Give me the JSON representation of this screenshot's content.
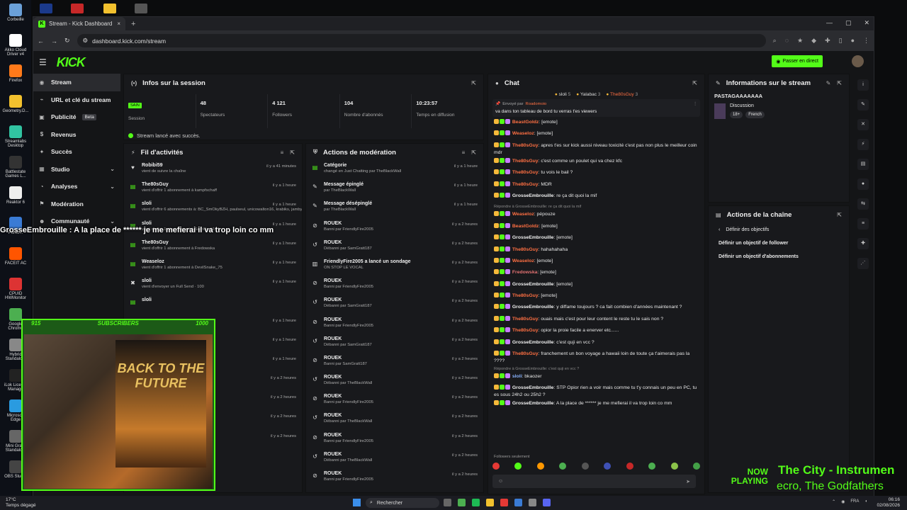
{
  "desktop": {
    "icons": [
      {
        "label": "Corbeille",
        "color": "#6aa0d8"
      },
      {
        "label": "Akko Cloud Driver v4",
        "color": "#ffffff"
      },
      {
        "label": "Firefox",
        "color": "#ff7a1a"
      },
      {
        "label": "Geometry.D...",
        "color": "#f2c12e"
      },
      {
        "label": "Streamlabs Desktop",
        "color": "#31c3a2"
      },
      {
        "label": "Battlestate Games L...",
        "color": "#333333"
      },
      {
        "label": "Reaktor 6",
        "color": "#eeeeee"
      },
      {
        "label": "Punto...",
        "color": "#3a7bd5"
      },
      {
        "label": "FACEIT AC",
        "color": "#ff5500"
      },
      {
        "label": "CPUID HWMonitor",
        "color": "#d33"
      },
      {
        "label": "Google Chrome",
        "color": "#4caf50"
      },
      {
        "label": "Hybrid Standalo...",
        "color": "#888"
      },
      {
        "label": "iLok Licen... Manage",
        "color": "#222"
      },
      {
        "label": "Microsoft Edge",
        "color": "#2a9be0"
      },
      {
        "label": "Mini Gra... Standalo...",
        "color": "#666"
      },
      {
        "label": "OBS Stud...",
        "color": "#444"
      }
    ]
  },
  "browser": {
    "tab_title": "Stream - Kick Dashboard",
    "tab_close": "×",
    "new_tab": "+",
    "window_controls": [
      "—",
      "▢",
      "✕"
    ],
    "url": "dashboard.kick.com/stream"
  },
  "header": {
    "logo": "KICK",
    "go_live_label": "Passer en direct"
  },
  "sidebar": {
    "items": [
      {
        "icon": "◉",
        "label": "Stream",
        "active": true
      },
      {
        "icon": "⌁",
        "label": "URL et clé du stream"
      },
      {
        "icon": "▣",
        "label": "Publicité",
        "badge": "Beta"
      },
      {
        "icon": "$",
        "label": "Revenus"
      },
      {
        "icon": "✦",
        "label": "Succès"
      },
      {
        "icon": "▦",
        "label": "Studio",
        "chevron": "⌄"
      },
      {
        "icon": "◔",
        "label": "Analyses",
        "chevron": "⌄"
      },
      {
        "icon": "⚑",
        "label": "Modération"
      },
      {
        "icon": "☻",
        "label": "Communauté",
        "chevron": "⌄"
      }
    ]
  },
  "session": {
    "title": "Infos sur la session",
    "stats": [
      {
        "value": "SAIN",
        "label": "Session"
      },
      {
        "value": "48",
        "label": "Spectateurs"
      },
      {
        "value": "4 121",
        "label": "Followers"
      },
      {
        "value": "104",
        "label": "Nombre d'abonnés"
      },
      {
        "value": "10:23:57",
        "label": "Temps en diffusion"
      }
    ],
    "success_message": "Stream lancé avec succès."
  },
  "activity": {
    "title": "Fil d'activités",
    "rows": [
      {
        "icon": "♥",
        "name": "Robibi59",
        "sub": "vient de suivre la chaîne",
        "time": "il y a 41 minutes"
      },
      {
        "icon": "▤",
        "name": "The80sGuy",
        "sub": "vient d'offrir 1 abonnement à kampfschaff",
        "time": "il y a 1 heure"
      },
      {
        "icon": "▤",
        "name": "sloli",
        "sub": "vient d'offrir 6 abonnements à: BC_SmOkyBZH, paulseul, unicowalton16, krabiks, jamby",
        "time": "il y a 1 heure"
      },
      {
        "icon": "▤",
        "name": "sloli",
        "sub": "vient d'offrir 1 abonnement à SamGratt187",
        "time": "il y a 1 heure"
      },
      {
        "icon": "▤",
        "name": "The80sGuy",
        "sub": "vient d'offrir 1 abonnement à Fredowska",
        "time": "il y a 1 heure"
      },
      {
        "icon": "▤",
        "name": "Weaseloz",
        "sub": "vient d'offrir 1 abonnement à DevilSnake_75",
        "time": "il y a 1 heure"
      },
      {
        "icon": "✖",
        "name": "sloli",
        "sub": "vient d'envoyer un Full Send · 100",
        "time": "il y a 1 heure"
      },
      {
        "icon": "▤",
        "name": "sloli",
        "sub": "",
        "time": ""
      },
      {
        "icon": "▤",
        "name": "",
        "sub": "",
        "time": "il y a 1 heure"
      },
      {
        "icon": "▤",
        "name": "",
        "sub": "",
        "time": "il y a 1 heure"
      },
      {
        "icon": "▤",
        "name": "",
        "sub": "",
        "time": "il y a 1 heure"
      },
      {
        "icon": "▤",
        "name": "",
        "sub": "",
        "time": "il y a 2 heures"
      },
      {
        "icon": "▤",
        "name": "",
        "sub": "",
        "time": "il y a 2 heures"
      },
      {
        "icon": "▤",
        "name": "",
        "sub": "",
        "time": "il y a 2 heures"
      },
      {
        "icon": "▤",
        "name": "",
        "sub": "",
        "time": "il y a 2 heures"
      }
    ]
  },
  "moderation": {
    "title": "Actions de modération",
    "rows": [
      {
        "icon": "▤",
        "name": "Catégorie",
        "sub": "changé en Just Chatting par TheBlackWall",
        "time": "il y a 1 heure"
      },
      {
        "icon": "✎",
        "name": "Message épinglé",
        "sub": "par TheBlackWall",
        "time": "il y a 1 heure"
      },
      {
        "icon": "✎",
        "name": "Message désépinglé",
        "sub": "par TheBlackWall",
        "time": "il y a 1 heure"
      },
      {
        "icon": "⊘",
        "name": "ROUEK",
        "sub": "Banni par FriendlyFire2005",
        "time": "il y a 2 heures"
      },
      {
        "icon": "↺",
        "name": "ROUEK",
        "sub": "Débanni par SamGratt187",
        "time": "il y a 2 heures"
      },
      {
        "icon": "▥",
        "name": "FriendlyFire2005 a lancé un sondage",
        "sub": "ON STOP LE VOCAL",
        "time": "il y a 2 heures"
      },
      {
        "icon": "⊘",
        "name": "ROUEK",
        "sub": "Banni par FriendlyFire2005",
        "time": "il y a 2 heures"
      },
      {
        "icon": "↺",
        "name": "ROUEK",
        "sub": "Débanni par SamGratt187",
        "time": "il y a 2 heures"
      },
      {
        "icon": "⊘",
        "name": "ROUEK",
        "sub": "Banni par FriendlyFire2005",
        "time": "il y a 2 heures"
      },
      {
        "icon": "↺",
        "name": "ROUEK",
        "sub": "Débanni par SamGratt187",
        "time": "il y a 2 heures"
      },
      {
        "icon": "⊘",
        "name": "ROUEK",
        "sub": "Banni par SamGratt187",
        "time": "il y a 2 heures"
      },
      {
        "icon": "↺",
        "name": "ROUEK",
        "sub": "Débanni par TheBlackWall",
        "time": "il y a 2 heures"
      },
      {
        "icon": "⊘",
        "name": "ROUEK",
        "sub": "Banni par FriendlyFire2005",
        "time": "il y a 2 heures"
      },
      {
        "icon": "↺",
        "name": "ROUEK",
        "sub": "Débanni par TheBlackWall",
        "time": "il y a 2 heures"
      },
      {
        "icon": "⊘",
        "name": "ROUEK",
        "sub": "Banni par FriendlyFire2005",
        "time": "il y a 2 heures"
      },
      {
        "icon": "↺",
        "name": "ROUEK",
        "sub": "Débanni par TheBlackWall",
        "time": "il y a 2 heures"
      },
      {
        "icon": "⊘",
        "name": "ROUEK",
        "sub": "Banni par FriendlyFire2005",
        "time": "il y a 2 heures"
      }
    ]
  },
  "chat": {
    "title": "Chat",
    "top_gifters": [
      {
        "name": "sloli",
        "count": "5"
      },
      {
        "name": "Yalabac",
        "count": "3"
      },
      {
        "name": "The80sGuy",
        "count": "3"
      }
    ],
    "pinned": {
      "label": "Envoyé par",
      "author": "Roadomoio",
      "message": "va dans ton tableau de bord tu verras t'es viewers"
    },
    "messages": [
      {
        "user": "BeastGoldz",
        "color": "o",
        "text": "[emote]"
      },
      {
        "user": "Weaseloz",
        "color": "o",
        "text": "[emote]"
      },
      {
        "user": "The80sGuy",
        "color": "o",
        "text": "apres t'es sur kick aussi niveau toxicité c'est pas non plus le meilleur coin mdr"
      },
      {
        "user": "The80sGuy",
        "color": "o",
        "text": "c'est comme un poulet qui va chez kfc"
      },
      {
        "user": "The80sGuy",
        "color": "o",
        "text": "tu vois le bail ?"
      },
      {
        "user": "The80sGuy",
        "color": "o",
        "text": "MDR"
      },
      {
        "user": "GrosseEmbrouille",
        "color": "w",
        "text": "re ça dit quoi la mif"
      },
      {
        "reply": "Répondre à GrosseEmbrouille: re ça dit quoi la mif"
      },
      {
        "user": "Weaseloz",
        "color": "o",
        "text": "pépouze"
      },
      {
        "user": "BeastGoldz",
        "color": "o",
        "text": "[emote]"
      },
      {
        "user": "GrosseEmbrouille",
        "color": "w",
        "text": "[emote]"
      },
      {
        "user": "The80sGuy",
        "color": "o",
        "text": "hahahahaha"
      },
      {
        "user": "Weaseloz",
        "color": "o",
        "text": "[emote]"
      },
      {
        "user": "Fredowska",
        "color": "r",
        "text": "[emote]"
      },
      {
        "user": "GrosseEmbrouille",
        "color": "w",
        "text": "[emote]"
      },
      {
        "user": "The80sGuy",
        "color": "o",
        "text": "[emote]"
      },
      {
        "user": "GrosseEmbrouille",
        "color": "w",
        "text": "y diffame toujours ? ca fait combien d'années maintenant ?"
      },
      {
        "user": "The80sGuy",
        "color": "o",
        "text": "ouais mais c'est pour leur content le reste tu le sais non ?"
      },
      {
        "user": "The80sGuy",
        "color": "o",
        "text": "opior la proie facile a enerver etc......"
      },
      {
        "user": "GrosseEmbrouille",
        "color": "w",
        "text": "c'est quji en vcc ?"
      },
      {
        "user": "The80sGuy",
        "color": "o",
        "text": "franchement un bon voyage a hawaii loin de toute ça t'aimerais pas la ????"
      },
      {
        "reply": "Répondre à GrosseEmbrouille: c'est quji en vcc ?"
      },
      {
        "user": "sloli",
        "color": "c",
        "text": "bkaozer"
      },
      {
        "user": "GrosseEmbrouille",
        "color": "w",
        "text": "STP Opior rien a voir mais comme tu t'y connais un peu en PC, tu es sous 24h2 ou 25h2 ?"
      },
      {
        "user": "GrosseEmbrouille",
        "color": "w",
        "text": "A la place de ****** je me mefierai il va trop loin co mm"
      }
    ],
    "followers_only": "Followers seulement",
    "emote_colors": [
      "#e53935",
      "#53fc18",
      "#ff9800",
      "#4caf50",
      "#555",
      "#3f51b5",
      "#c62828",
      "#4caf50",
      "#8bc34a",
      "#43a047"
    ]
  },
  "stream_info": {
    "title": "Informations sur le stream",
    "stream_title": "PASTAGAAAAAAA",
    "category": "Discussion",
    "tags": [
      "18+",
      "French"
    ]
  },
  "channel_actions": {
    "title": "Actions de la chaîne",
    "back_label": "Définir des objectifs",
    "items": [
      "Définir un objectif de follower",
      "Définir un objectif d'abonnements"
    ]
  },
  "overlay": {
    "alert": "GrosseEmbrouille : A la place de ****** je me mefierai il va trop loin co mm",
    "sub_goal_start": "915",
    "sub_goal_label": "SUBSCRIBERS",
    "sub_goal_end": "1000",
    "poster": "BACK TO THE FUTURE",
    "now_playing": "NOW PLAYING",
    "track_title": "The City - Instrumen",
    "track_artist": "ecro, The Godfathers"
  },
  "taskbar": {
    "temp": "17°C",
    "weather": "Temps dégagé",
    "search": "Rechercher",
    "lang": "FRA",
    "time": "06:16",
    "date": "02/08/2026"
  }
}
